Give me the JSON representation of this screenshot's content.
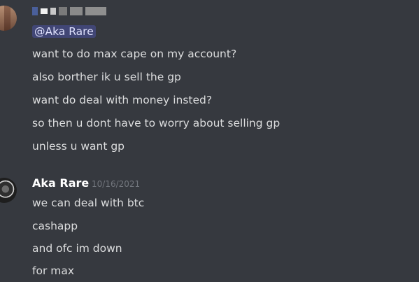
{
  "first_group": {
    "mention": "@Aka Rare",
    "lines": [
      "want to do max cape on my account?",
      "also borther ik u sell the gp",
      "want do deal with money insted?",
      "so then u dont have to worry about selling gp",
      "unless u want gp"
    ]
  },
  "second_group": {
    "author": "Aka Rare",
    "timestamp": "10/16/2021",
    "lines": [
      "we can deal with btc",
      "cashapp",
      "and ofc im down",
      "for max"
    ]
  },
  "colors": {
    "background": "#36393f",
    "message_text": "#dcddde",
    "mention_bg": "#414675",
    "mention_text": "#dee0fc",
    "timestamp": "#72767d"
  }
}
